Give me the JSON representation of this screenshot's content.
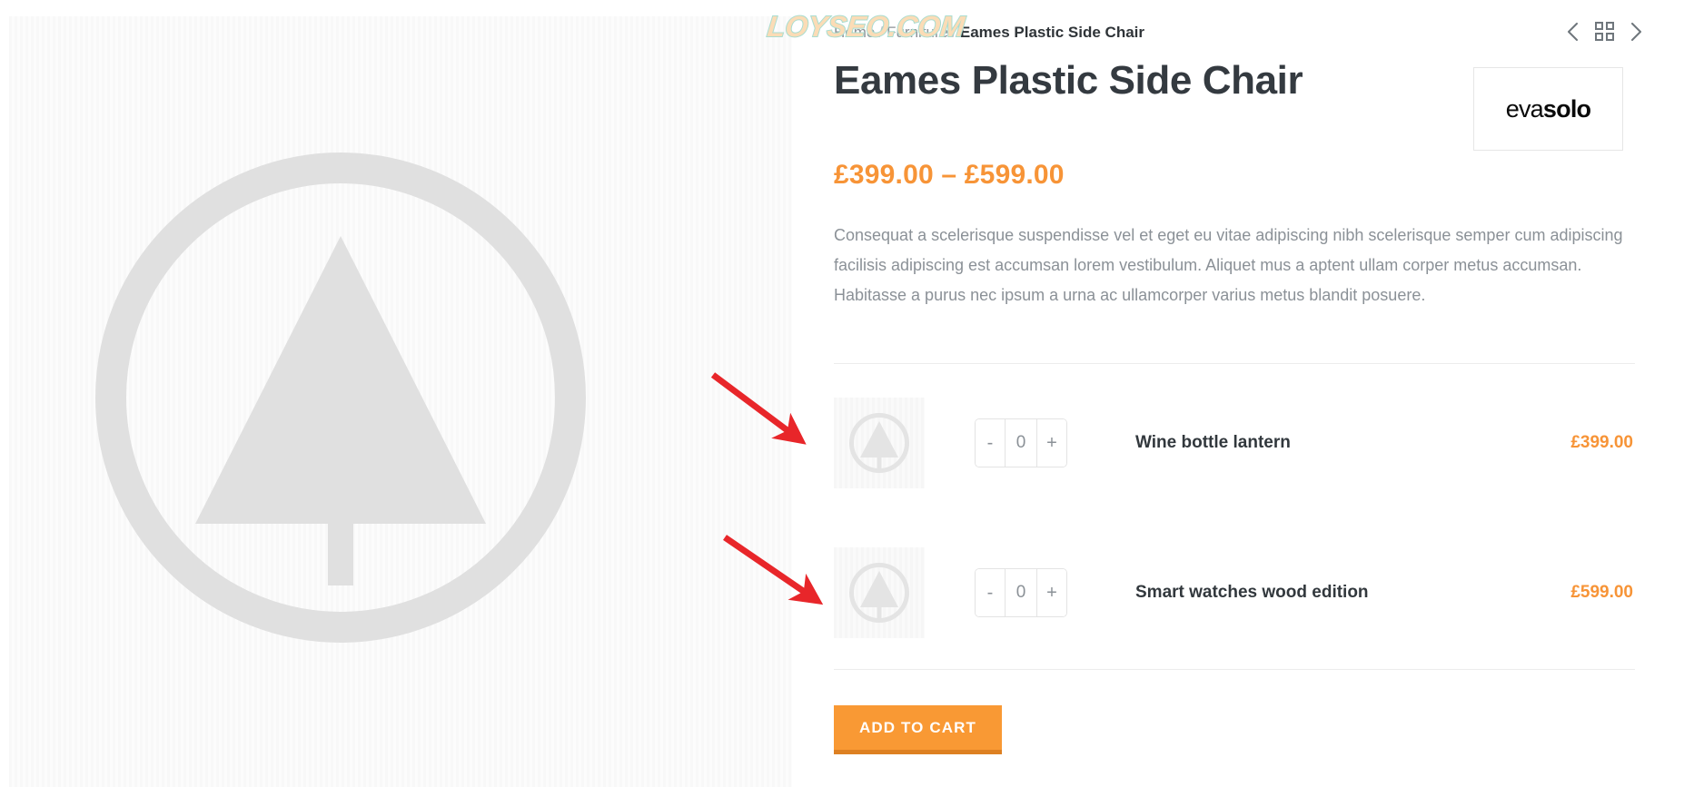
{
  "breadcrumb": {
    "items": [
      {
        "label": "Home",
        "current": false
      },
      {
        "label": "Furniture",
        "current": false
      },
      {
        "label": "Eames Plastic Side Chair",
        "current": true
      }
    ],
    "separator": "/"
  },
  "nav": {
    "prev_label": "‹",
    "grid_label": "grid",
    "next_label": "›"
  },
  "product": {
    "title": "Eames Plastic Side Chair",
    "price_range": "£399.00 – £599.00",
    "description": "Consequat a scelerisque suspendisse vel et eget eu vitae adipiscing nibh scelerisque semper cum adipiscing facilisis adipiscing est accumsan lorem vestibulum. Aliquet mus a aptent ullam corper metus accumsan. Habitasse a purus nec ipsum a urna ac ullamcorper varius metus blandit posuere.",
    "brand": {
      "light": "eva",
      "bold": "solo"
    }
  },
  "grouped_products": [
    {
      "name": "Wine bottle lantern",
      "price": "£399.00",
      "quantity": "0",
      "decrement_label": "-",
      "increment_label": "+"
    },
    {
      "name": "Smart watches wood edition",
      "price": "£599.00",
      "quantity": "0",
      "decrement_label": "-",
      "increment_label": "+"
    }
  ],
  "actions": {
    "add_to_cart_label": "ADD TO CART"
  },
  "watermark": {
    "text": "LOYSEO.COM"
  },
  "colors": {
    "accent_orange": "#f79437",
    "button_orange": "#f99934",
    "button_orange_dark": "#dd8022",
    "title_dark": "#343a40",
    "body_gray": "#8b9197",
    "placeholder_gray": "#e0e0e0",
    "annotation_red": "#e8262a"
  }
}
